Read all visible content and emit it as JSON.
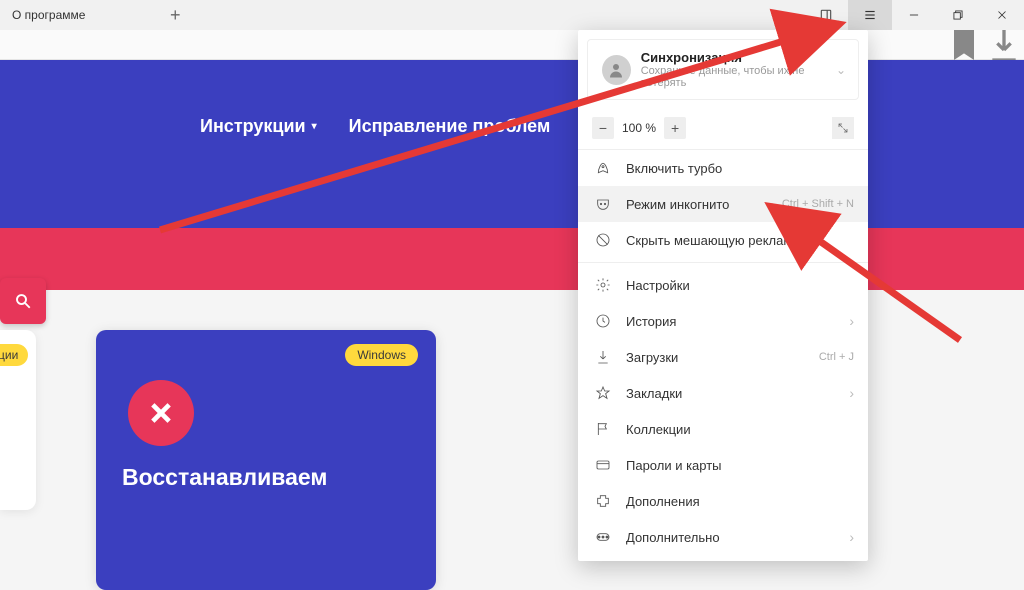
{
  "titlebar": {
    "tab_title": "О программе"
  },
  "nav": {
    "item1": "Инструкции",
    "item2": "Исправление проблем"
  },
  "cards": {
    "edge_badge": "ции",
    "main_badge": "Windows",
    "main_title": "Восстанавливаем"
  },
  "menu": {
    "sync_title": "Синхронизация",
    "sync_sub": "Сохраните данные, чтобы их не потерять",
    "zoom_value": "100 %",
    "items": {
      "turbo": "Включить турбо",
      "incognito": {
        "label": "Режим инкогнито",
        "shortcut": "Ctrl + Shift + N"
      },
      "hide_ads": "Скрыть мешающую рекламу",
      "settings": "Настройки",
      "history": "История",
      "downloads": {
        "label": "Загрузки",
        "shortcut": "Ctrl + J"
      },
      "bookmarks": "Закладки",
      "collections": "Коллекции",
      "passwords": "Пароли и карты",
      "extensions": "Дополнения",
      "more": "Дополнительно"
    }
  }
}
